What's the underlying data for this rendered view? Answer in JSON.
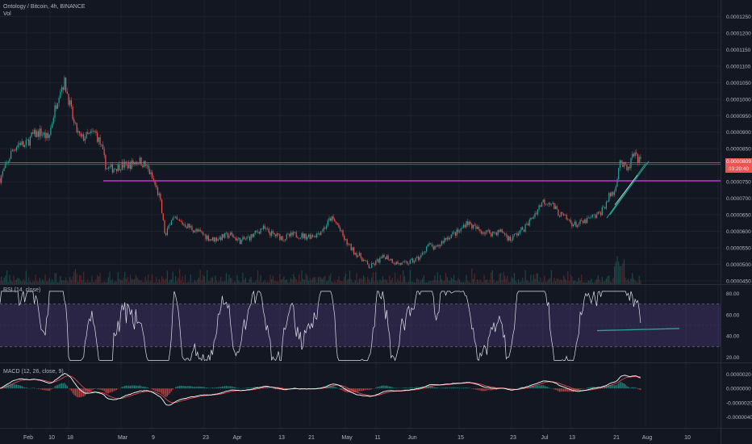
{
  "chart_data": [
    {
      "type": "candlestick",
      "title": "Ontology / Bitcoin, 4h, BINANCE",
      "subtitle": "Vol",
      "ylim": [
        4.4e-05,
        0.00013
      ],
      "yticks": [
        "0.0001250",
        "0.0001200",
        "0.0001150",
        "0.0001100",
        "0.0001050",
        "0.0001000",
        "0.0000950",
        "0.0000900",
        "0.0000850",
        "0.0000800",
        "0.0000750",
        "0.0000700",
        "0.0000650",
        "0.0000600",
        "0.0000550",
        "0.0000500",
        "0.0000450"
      ],
      "yticks_values": [
        0.000125,
        0.00012,
        0.000115,
        0.00011,
        0.000105,
        0.0001,
        9.5e-05,
        9e-05,
        8.5e-05,
        8e-05,
        7.5e-05,
        7e-05,
        6.5e-05,
        6e-05,
        5.5e-05,
        5e-05,
        4.5e-05
      ],
      "xlabels": [
        "Feb",
        "10",
        "18",
        "Mar",
        "9",
        "23",
        "Apr",
        "13",
        "21",
        "May",
        "11",
        "Jun",
        "15",
        "23",
        "Jul",
        "13",
        "21",
        "Aug",
        "10"
      ],
      "x_path": [
        [
          0,
          7.6e-05
        ],
        [
          8,
          8e-05
        ],
        [
          15,
          8.45e-05
        ],
        [
          25,
          8.7e-05
        ],
        [
          30,
          8.55e-05
        ],
        [
          40,
          8.9e-05
        ],
        [
          50,
          9e-05
        ],
        [
          60,
          8.8e-05
        ],
        [
          67,
          9.6e-05
        ],
        [
          74,
          0.000103
        ],
        [
          80,
          0.000105
        ],
        [
          86,
          9.9e-05
        ],
        [
          92,
          9.2e-05
        ],
        [
          100,
          8.8e-05
        ],
        [
          110,
          8.9e-05
        ],
        [
          118,
          9e-05
        ],
        [
          125,
          8.6e-05
        ],
        [
          132,
          7.9e-05
        ],
        [
          140,
          7.9e-05
        ],
        [
          150,
          8e-05
        ],
        [
          160,
          8e-05
        ],
        [
          172,
          8.15e-05
        ],
        [
          180,
          8e-05
        ],
        [
          185,
          7.8e-05
        ],
        [
          192,
          7.4e-05
        ],
        [
          198,
          7e-05
        ],
        [
          205,
          5.8e-05
        ],
        [
          212,
          6.4e-05
        ],
        [
          220,
          6.3e-05
        ],
        [
          230,
          6.2e-05
        ],
        [
          240,
          6.05e-05
        ],
        [
          252,
          5.9e-05
        ],
        [
          262,
          5.75e-05
        ],
        [
          272,
          5.8e-05
        ],
        [
          285,
          5.9e-05
        ],
        [
          298,
          5.7e-05
        ],
        [
          312,
          5.85e-05
        ],
        [
          325,
          6.1e-05
        ],
        [
          338,
          5.9e-05
        ],
        [
          352,
          5.8e-05
        ],
        [
          365,
          5.9e-05
        ],
        [
          378,
          5.85e-05
        ],
        [
          392,
          5.9e-05
        ],
        [
          402,
          6.1e-05
        ],
        [
          410,
          6.4e-05
        ],
        [
          418,
          6.2e-05
        ],
        [
          428,
          5.7e-05
        ],
        [
          438,
          5.4e-05
        ],
        [
          448,
          5.2e-05
        ],
        [
          458,
          4.9e-05
        ],
        [
          468,
          5.1e-05
        ],
        [
          478,
          5.25e-05
        ],
        [
          490,
          5.05e-05
        ],
        [
          500,
          5e-05
        ],
        [
          512,
          5.1e-05
        ],
        [
          522,
          5.25e-05
        ],
        [
          530,
          5.6e-05
        ],
        [
          540,
          5.45e-05
        ],
        [
          550,
          5.75e-05
        ],
        [
          560,
          5.9e-05
        ],
        [
          570,
          6e-05
        ],
        [
          578,
          6.3e-05
        ],
        [
          588,
          6.1e-05
        ],
        [
          598,
          6e-05
        ],
        [
          610,
          5.95e-05
        ],
        [
          622,
          6e-05
        ],
        [
          632,
          5.75e-05
        ],
        [
          642,
          5.95e-05
        ],
        [
          652,
          6.15e-05
        ],
        [
          662,
          6.5e-05
        ],
        [
          672,
          6.9e-05
        ],
        [
          682,
          6.9e-05
        ],
        [
          690,
          6.6e-05
        ],
        [
          700,
          6.4e-05
        ],
        [
          712,
          6.2e-05
        ],
        [
          722,
          6.25e-05
        ],
        [
          732,
          6.4e-05
        ],
        [
          742,
          6.5e-05
        ],
        [
          750,
          6.8e-05
        ],
        [
          756,
          7.1e-05
        ],
        [
          762,
          7.2e-05
        ],
        [
          768,
          8.2e-05
        ],
        [
          772,
          8e-05
        ],
        [
          778,
          7.8e-05
        ],
        [
          784,
          8.3e-05
        ],
        [
          790,
          8.2e-05
        ],
        [
          795,
          8.05e-05
        ]
      ],
      "price_levels": [
        {
          "name": "last-price-line",
          "value": 8.08e-05,
          "color": "#ef5350"
        },
        {
          "name": "resistance-line-red",
          "value": 8.03e-05,
          "color": "#a33a36"
        },
        {
          "name": "support-line-purple",
          "value": 7.53e-05,
          "color": "#b72dc5"
        }
      ],
      "last_price_label": "0.0000809",
      "countdown_label": "03:20:40"
    },
    {
      "type": "line",
      "title": "RSI (14, close)",
      "ylim": [
        15,
        88
      ],
      "yticks": [
        "80.00",
        "60.00",
        "40.00",
        "20.00"
      ],
      "yticks_values": [
        80,
        60,
        40,
        20
      ],
      "band": [
        30,
        70
      ],
      "band_color": "#7e57c2",
      "line_color": "#e0e3eb",
      "trendline": {
        "x0": 740,
        "y0": 45,
        "x1": 842,
        "y1": 47,
        "color": "#26a69a"
      }
    },
    {
      "type": "line",
      "title": "MACD (12, 26, close, 9)",
      "ylim": [
        -5.5e-08,
        3.5e-08
      ],
      "yticks": [
        "0.0000020",
        "0.0000000",
        "-0.0000020",
        "-0.0000040"
      ],
      "yticks_values": [
        2e-08,
        0.0,
        -2e-08,
        -4e-08
      ],
      "series": [
        {
          "name": "MACD",
          "color": "#ffffff"
        },
        {
          "name": "Signal",
          "color": "#ef5350"
        }
      ],
      "histogram_colors": {
        "positive": "#26a69a",
        "negative": "#ef5350"
      }
    }
  ],
  "colors": {
    "background": "#131722",
    "grid": "#1e222d",
    "axis_text": "#b2b5be",
    "up": "#26a69a",
    "down": "#ef5350",
    "green_channel": "#26a69a"
  }
}
